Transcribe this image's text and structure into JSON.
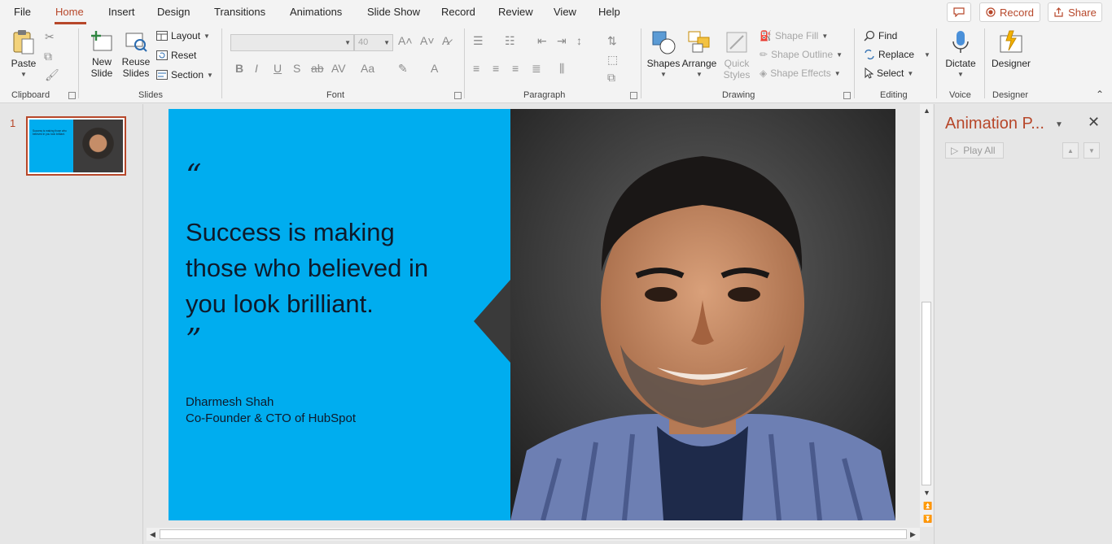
{
  "menu": {
    "tabs": [
      "File",
      "Home",
      "Insert",
      "Design",
      "Transitions",
      "Animations",
      "Slide Show",
      "Record",
      "Review",
      "View",
      "Help"
    ],
    "active_tab": "Home",
    "record_label": "Record",
    "share_label": "Share"
  },
  "ribbon": {
    "clipboard": {
      "label": "Clipboard",
      "paste": "Paste"
    },
    "slides": {
      "label": "Slides",
      "new_slide_1": "New",
      "new_slide_2": "Slide",
      "reuse_1": "Reuse",
      "reuse_2": "Slides",
      "layout": "Layout",
      "reset": "Reset",
      "section": "Section"
    },
    "font": {
      "label": "Font",
      "font_name": "",
      "font_size": "40"
    },
    "paragraph": {
      "label": "Paragraph"
    },
    "drawing": {
      "label": "Drawing",
      "shapes": "Shapes",
      "arrange": "Arrange",
      "quick_1": "Quick",
      "quick_2": "Styles",
      "shape_fill": "Shape Fill",
      "shape_outline": "Shape Outline",
      "shape_effects": "Shape Effects"
    },
    "editing": {
      "label": "Editing",
      "find": "Find",
      "replace": "Replace",
      "select": "Select"
    },
    "voice": {
      "label": "Voice",
      "dictate": "Dictate"
    },
    "designer": {
      "label": "Designer",
      "designer": "Designer"
    }
  },
  "thumbnails": [
    {
      "number": "1",
      "text": "Success is making those who believed in you look brilliant."
    }
  ],
  "slide": {
    "quote_open": "“",
    "quote_lines": [
      "Success is making",
      "those who believed in",
      "you look brilliant."
    ],
    "quote_close": "”",
    "author_name": "Dharmesh Shah",
    "author_title": "Co-Founder & CTO of HubSpot",
    "accent_color": "#00adef"
  },
  "animation_pane": {
    "title": "Animation P...",
    "play_all": "Play All"
  },
  "colors": {
    "brand": "#b7472a",
    "slide_blue": "#00adef",
    "text_dark": "#0e1a2b"
  }
}
